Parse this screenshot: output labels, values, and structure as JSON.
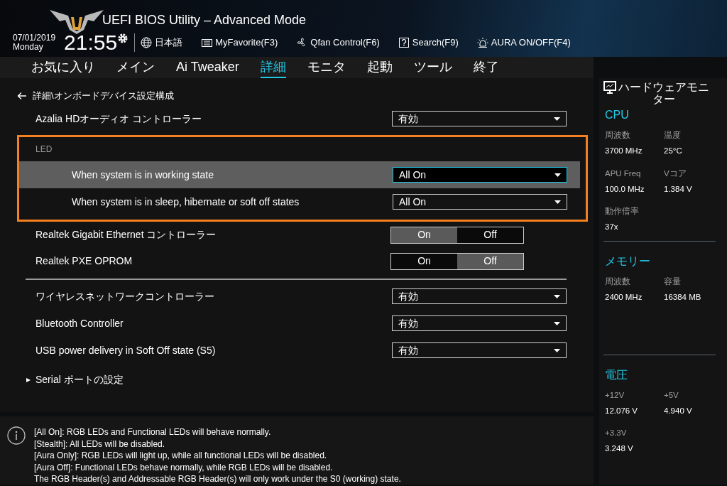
{
  "header": {
    "title": "UEFI BIOS Utility – Advanced Mode",
    "date": "07/01/2019",
    "day": "Monday",
    "time": "21:55",
    "toolbar": [
      {
        "kind": "globe",
        "label": "日本語"
      },
      {
        "kind": "favorite",
        "label": "MyFavorite(F3)"
      },
      {
        "kind": "fan",
        "label": "Qfan Control(F6)"
      },
      {
        "kind": "search",
        "label": "Search(F9)"
      },
      {
        "kind": "aura",
        "label": "AURA ON/OFF(F4)"
      }
    ]
  },
  "tabs": [
    {
      "label": "お気に入り",
      "selected": false
    },
    {
      "label": "メイン",
      "selected": false
    },
    {
      "label": "Ai Tweaker",
      "selected": false
    },
    {
      "label": "詳細",
      "selected": true
    },
    {
      "label": "モニタ",
      "selected": false
    },
    {
      "label": "起動",
      "selected": false
    },
    {
      "label": "ツール",
      "selected": false
    },
    {
      "label": "終了",
      "selected": false
    }
  ],
  "breadcrumb": "詳細\\オンボードデバイス設定構成",
  "settings": [
    {
      "kind": "select",
      "label": "Azalia HDオーディオ コントローラー",
      "value": "有効",
      "selected": false
    },
    {
      "kind": "group",
      "label": "LED",
      "children": [
        {
          "kind": "select",
          "label": "When system is in working state",
          "value": "All On",
          "selected": true
        },
        {
          "kind": "select",
          "label": "When system is in sleep, hibernate or soft off states",
          "value": "All On",
          "selected": false
        }
      ]
    },
    {
      "kind": "toggle",
      "label": "Realtek Gigabit Ethernet コントローラー",
      "options": [
        {
          "label": "On",
          "selected": true
        },
        {
          "label": "Off",
          "selected": false
        }
      ]
    },
    {
      "kind": "toggle",
      "label": "Realtek PXE OPROM",
      "options": [
        {
          "label": "On",
          "selected": false
        },
        {
          "label": "Off",
          "selected": true
        }
      ]
    },
    {
      "kind": "divider"
    },
    {
      "kind": "select",
      "label": "ワイヤレスネットワークコントローラー",
      "value": "有効",
      "selected": false
    },
    {
      "kind": "select",
      "label": "Bluetooth Controller",
      "value": "有効",
      "selected": false
    },
    {
      "kind": "select",
      "label": "USB power delivery in Soft Off state (S5)",
      "value": "有効",
      "selected": false
    },
    {
      "kind": "submenu",
      "label": "Serial ポートの設定"
    }
  ],
  "help": [
    "[All On]: RGB LEDs and Functional LEDs will behave normally.",
    "[Stealth]: All LEDs will be disabled.",
    "[Aura Only]: RGB LEDs will light up, while all functional LEDs will be disabled.",
    "[Aura Off]: Functional LEDs behave normally, while RGB LEDs will be disabled.",
    "The RGB Header(s) and Addressable RGB Header(s) will only work under the S0 (working) state."
  ],
  "monitor": {
    "title": "ハードウェアモニター",
    "sections": [
      {
        "title": "CPU",
        "items": [
          {
            "label": "周波数",
            "value": "3700 MHz"
          },
          {
            "label": "温度",
            "value": "25°C"
          },
          {
            "label": "APU Freq",
            "value": "100.0 MHz"
          },
          {
            "label": "Vコア",
            "value": "1.384 V"
          },
          {
            "label": "動作倍率",
            "value": "37x"
          }
        ]
      },
      {
        "title": "メモリー",
        "items": [
          {
            "label": "周波数",
            "value": "2400 MHz"
          },
          {
            "label": "容量",
            "value": "16384 MB"
          }
        ]
      },
      {
        "title": "電圧",
        "items": [
          {
            "label": "+12V",
            "value": "12.076 V"
          },
          {
            "label": "+5V",
            "value": "4.940 V"
          },
          {
            "label": "+3.3V",
            "value": "3.248 V"
          }
        ]
      }
    ]
  }
}
